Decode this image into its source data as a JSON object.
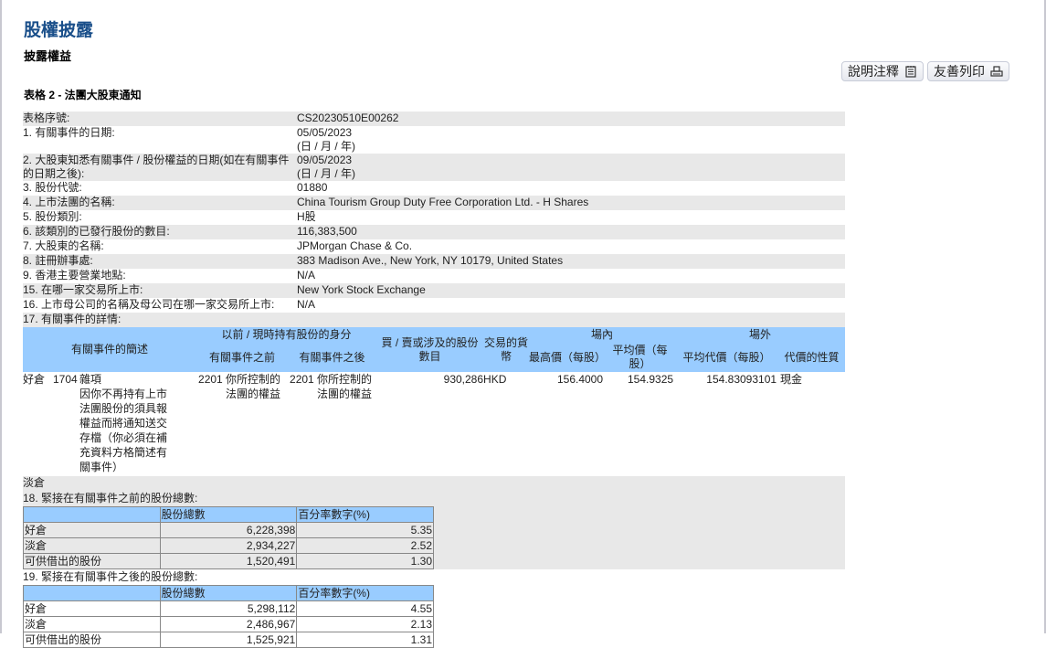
{
  "header": {
    "title": "股權披露",
    "subtitle": "披露權益",
    "form_title": "表格 2 - 法團大股東通知"
  },
  "buttons": {
    "explain": "說明注釋",
    "print": "友善列印"
  },
  "fields": [
    {
      "label": "表格序號:",
      "value": "CS20230510E00262"
    },
    {
      "label": "1. 有關事件的日期:",
      "value": "05/05/2023",
      "note": "(日 / 月 / 年)"
    },
    {
      "label": "2. 大股東知悉有關事件 / 股份權益的日期(如在有關事件的日期之後):",
      "value": "09/05/2023",
      "note": "(日 / 月 / 年)"
    },
    {
      "label": "3. 股份代號:",
      "value": "01880"
    },
    {
      "label": "4. 上市法團的名稱:",
      "value": "China Tourism Group Duty Free Corporation Ltd. - H Shares"
    },
    {
      "label": "5. 股份類別:",
      "value": "H股"
    },
    {
      "label": "6. 該類別的已發行股份的數目:",
      "value": "116,383,500"
    },
    {
      "label": "7. 大股東的名稱:",
      "value": "JPMorgan Chase & Co."
    },
    {
      "label": "8. 註冊辦事處:",
      "value": "383 Madison Ave., New York, NY 10179, United States"
    },
    {
      "label": "9. 香港主要營業地點:",
      "value": "N/A"
    },
    {
      "label": "15. 在哪一家交易所上市:",
      "value": "New York Stock Exchange"
    },
    {
      "label": "16. 上市母公司的名稱及母公司在哪一家交易所上市:",
      "value": "N/A"
    },
    {
      "label": "17. 有關事件的詳情:",
      "value": ""
    }
  ],
  "event_table": {
    "headers": {
      "desc": "有關事件的簡述",
      "capacity": "以前 / 現時持有股份的身分",
      "before": "有關事件之前",
      "after": "有關事件之後",
      "shares": "買 / 賣或涉及的股份數目",
      "currency": "交易的貨幣",
      "on_exchange": "場內",
      "high": "最高價（每股）",
      "avg": "平均價（每股）",
      "off_exchange": "場外",
      "avg_consideration": "平均代價（每股）",
      "nature": "代價的性質"
    },
    "row": {
      "position": "好倉",
      "code": "1704",
      "desc_title": "雜項",
      "desc": "因你不再持有上市法團股份的須具報權益而將通知送交存檔（你必須在補充資料方格簡述有關事件）",
      "before_code": "2201",
      "before_text": "你所控制的法團的權益",
      "after_code": "2201",
      "after_text": "你所控制的法團的權益",
      "shares": "930,286",
      "currency": "HKD",
      "high": "156.4000",
      "avg": "154.9325",
      "avg_consideration": "154.83093101",
      "nature": "現金"
    },
    "short_label": "淡倉"
  },
  "sec18": {
    "title": "18. 緊接在有關事件之前的股份總數:",
    "col1": "股份總數",
    "col2": "百分率數字(%)",
    "rows": [
      {
        "label": "好倉",
        "shares": "6,228,398",
        "pct": "5.35"
      },
      {
        "label": "淡倉",
        "shares": "2,934,227",
        "pct": "2.52"
      },
      {
        "label": "可供借出的股份",
        "shares": "1,520,491",
        "pct": "1.30"
      }
    ]
  },
  "sec19": {
    "title": "19. 緊接在有關事件之後的股份總數:",
    "col1": "股份總數",
    "col2": "百分率數字(%)",
    "rows": [
      {
        "label": "好倉",
        "shares": "5,298,112",
        "pct": "4.55"
      },
      {
        "label": "淡倉",
        "shares": "2,486,967",
        "pct": "2.13"
      },
      {
        "label": "可供借出的股份",
        "shares": "1,525,921",
        "pct": "1.31"
      }
    ]
  }
}
